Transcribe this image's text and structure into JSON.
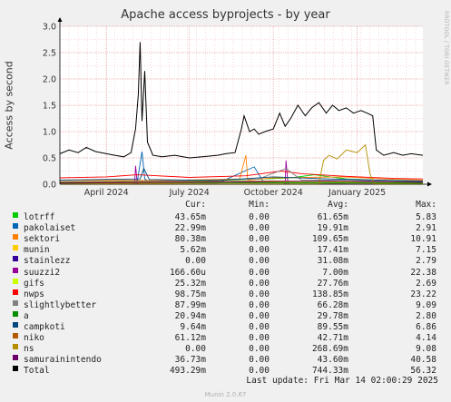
{
  "chart_data": {
    "type": "line",
    "title": "Apache access byprojects - by year",
    "ylabel": "Access by second",
    "xlabel": "",
    "ylim": [
      0,
      3.0
    ],
    "yticks": [
      "0.0",
      "0.5",
      "1.0",
      "1.5",
      "2.0",
      "2.5",
      "3.0"
    ],
    "ytick_values": [
      0,
      0.5,
      1.0,
      1.5,
      2.0,
      2.5,
      3.0
    ],
    "x_range": [
      "2024-02-10",
      "2025-03-14"
    ],
    "xticks": [
      {
        "date": "2024-04-01",
        "label": "April 2024"
      },
      {
        "date": "2024-07-01",
        "label": "July 2024"
      },
      {
        "date": "2024-10-01",
        "label": "October 2024"
      },
      {
        "date": "2025-01-01",
        "label": "January 2025"
      }
    ],
    "grid": true,
    "series": [
      {
        "name": "lotrff",
        "color": "#00cc00",
        "points": [
          [
            "2024-02-10",
            0.05
          ],
          [
            "2024-05-01",
            0.06
          ],
          [
            "2024-08-01",
            0.07
          ],
          [
            "2024-10-20",
            0.12
          ],
          [
            "2024-11-15",
            0.18
          ],
          [
            "2024-12-20",
            0.1
          ],
          [
            "2025-02-01",
            0.07
          ],
          [
            "2025-03-14",
            0.04
          ]
        ]
      },
      {
        "name": "pakolaiset",
        "color": "#0066b3",
        "points": [
          [
            "2024-02-10",
            0.02
          ],
          [
            "2024-04-10",
            0.03
          ],
          [
            "2024-05-05",
            0.06
          ],
          [
            "2024-05-10",
            0.62
          ],
          [
            "2024-05-13",
            0.1
          ],
          [
            "2024-05-20",
            0.03
          ],
          [
            "2024-08-01",
            0.02
          ],
          [
            "2024-09-10",
            0.33
          ],
          [
            "2024-09-20",
            0.05
          ],
          [
            "2024-12-01",
            0.02
          ],
          [
            "2025-03-14",
            0.02
          ]
        ]
      },
      {
        "name": "sektori",
        "color": "#ff8000",
        "points": [
          [
            "2024-02-10",
            0.08
          ],
          [
            "2024-06-01",
            0.07
          ],
          [
            "2024-08-25",
            0.1
          ],
          [
            "2024-09-01",
            0.55
          ],
          [
            "2024-09-03",
            0.08
          ],
          [
            "2024-10-01",
            0.12
          ],
          [
            "2024-12-15",
            0.14
          ],
          [
            "2025-02-01",
            0.1
          ],
          [
            "2025-03-14",
            0.08
          ]
        ]
      },
      {
        "name": "munin",
        "color": "#ffcc00",
        "points": [
          [
            "2024-02-10",
            0.01
          ],
          [
            "2024-08-01",
            0.02
          ],
          [
            "2025-01-01",
            0.02
          ],
          [
            "2025-03-14",
            0.01
          ]
        ]
      },
      {
        "name": "stainlezz",
        "color": "#330099",
        "points": [
          [
            "2024-02-10",
            0.03
          ],
          [
            "2024-07-01",
            0.03
          ],
          [
            "2024-10-01",
            0.04
          ],
          [
            "2025-03-14",
            0.03
          ]
        ]
      },
      {
        "name": "suuzzi2",
        "color": "#990099",
        "points": [
          [
            "2024-02-10",
            0.0
          ],
          [
            "2024-05-02",
            0.0
          ],
          [
            "2024-05-03",
            0.35
          ],
          [
            "2024-05-05",
            0.0
          ],
          [
            "2024-10-14",
            0.0
          ],
          [
            "2024-10-15",
            0.45
          ],
          [
            "2024-10-17",
            0.0
          ],
          [
            "2025-03-14",
            0.0
          ]
        ]
      },
      {
        "name": "gifs",
        "color": "#ccff00",
        "points": [
          [
            "2024-02-10",
            0.02
          ],
          [
            "2024-08-01",
            0.03
          ],
          [
            "2024-12-01",
            0.04
          ],
          [
            "2025-03-14",
            0.02
          ]
        ]
      },
      {
        "name": "nwps",
        "color": "#ff0000",
        "points": [
          [
            "2024-02-10",
            0.12
          ],
          [
            "2024-04-01",
            0.14
          ],
          [
            "2024-05-05",
            0.18
          ],
          [
            "2024-07-01",
            0.13
          ],
          [
            "2024-09-01",
            0.16
          ],
          [
            "2024-10-10",
            0.25
          ],
          [
            "2024-11-01",
            0.2
          ],
          [
            "2024-12-20",
            0.15
          ],
          [
            "2025-02-10",
            0.11
          ],
          [
            "2025-03-14",
            0.1
          ]
        ]
      },
      {
        "name": "slightlybetter",
        "color": "#808080",
        "points": [
          [
            "2024-02-10",
            0.05
          ],
          [
            "2024-06-01",
            0.06
          ],
          [
            "2024-09-15",
            0.1
          ],
          [
            "2024-10-15",
            0.3
          ],
          [
            "2024-11-01",
            0.08
          ],
          [
            "2025-03-14",
            0.06
          ]
        ]
      },
      {
        "name": "a",
        "color": "#008f00",
        "points": [
          [
            "2024-02-10",
            0.03
          ],
          [
            "2024-08-01",
            0.03
          ],
          [
            "2025-03-14",
            0.02
          ]
        ]
      },
      {
        "name": "campkoti",
        "color": "#00487d",
        "points": [
          [
            "2024-02-10",
            0.08
          ],
          [
            "2024-05-08",
            0.1
          ],
          [
            "2024-05-12",
            0.3
          ],
          [
            "2024-05-18",
            0.09
          ],
          [
            "2024-08-01",
            0.07
          ],
          [
            "2024-10-01",
            0.14
          ],
          [
            "2024-12-01",
            0.1
          ],
          [
            "2025-03-14",
            0.06
          ]
        ]
      },
      {
        "name": "niko",
        "color": "#b35a00",
        "points": [
          [
            "2024-02-10",
            0.04
          ],
          [
            "2024-07-01",
            0.05
          ],
          [
            "2024-10-01",
            0.06
          ],
          [
            "2025-03-14",
            0.04
          ]
        ]
      },
      {
        "name": "ns",
        "color": "#b38f00",
        "points": [
          [
            "2024-02-10",
            0.0
          ],
          [
            "2024-11-20",
            0.0
          ],
          [
            "2024-11-25",
            0.45
          ],
          [
            "2024-12-01",
            0.55
          ],
          [
            "2024-12-10",
            0.48
          ],
          [
            "2024-12-20",
            0.65
          ],
          [
            "2025-01-01",
            0.6
          ],
          [
            "2025-01-10",
            0.75
          ],
          [
            "2025-01-15",
            0.2
          ],
          [
            "2025-01-20",
            0.0
          ],
          [
            "2025-03-14",
            0.0
          ]
        ]
      },
      {
        "name": "samurainintendo",
        "color": "#6b006b",
        "points": [
          [
            "2024-02-10",
            0.02
          ],
          [
            "2024-08-01",
            0.04
          ],
          [
            "2024-12-01",
            0.06
          ],
          [
            "2025-03-14",
            0.04
          ]
        ]
      },
      {
        "name": "Total",
        "color": "#000000",
        "points": [
          [
            "2024-02-10",
            0.58
          ],
          [
            "2024-02-20",
            0.65
          ],
          [
            "2024-03-01",
            0.6
          ],
          [
            "2024-03-10",
            0.7
          ],
          [
            "2024-03-20",
            0.62
          ],
          [
            "2024-04-01",
            0.58
          ],
          [
            "2024-04-10",
            0.55
          ],
          [
            "2024-04-20",
            0.52
          ],
          [
            "2024-04-28",
            0.6
          ],
          [
            "2024-05-03",
            1.05
          ],
          [
            "2024-05-06",
            1.7
          ],
          [
            "2024-05-08",
            2.7
          ],
          [
            "2024-05-10",
            1.2
          ],
          [
            "2024-05-13",
            2.15
          ],
          [
            "2024-05-16",
            0.8
          ],
          [
            "2024-05-22",
            0.55
          ],
          [
            "2024-06-01",
            0.52
          ],
          [
            "2024-06-15",
            0.55
          ],
          [
            "2024-07-01",
            0.5
          ],
          [
            "2024-07-15",
            0.52
          ],
          [
            "2024-08-01",
            0.55
          ],
          [
            "2024-08-10",
            0.58
          ],
          [
            "2024-08-20",
            0.6
          ],
          [
            "2024-08-27",
            1.05
          ],
          [
            "2024-08-30",
            1.3
          ],
          [
            "2024-09-05",
            1.0
          ],
          [
            "2024-09-10",
            1.05
          ],
          [
            "2024-09-15",
            0.95
          ],
          [
            "2024-09-22",
            1.0
          ],
          [
            "2024-10-01",
            1.05
          ],
          [
            "2024-10-08",
            1.35
          ],
          [
            "2024-10-14",
            1.1
          ],
          [
            "2024-10-20",
            1.25
          ],
          [
            "2024-10-28",
            1.5
          ],
          [
            "2024-11-05",
            1.3
          ],
          [
            "2024-11-12",
            1.45
          ],
          [
            "2024-11-20",
            1.55
          ],
          [
            "2024-11-28",
            1.35
          ],
          [
            "2024-12-05",
            1.5
          ],
          [
            "2024-12-12",
            1.4
          ],
          [
            "2024-12-20",
            1.45
          ],
          [
            "2024-12-28",
            1.35
          ],
          [
            "2025-01-05",
            1.4
          ],
          [
            "2025-01-12",
            1.35
          ],
          [
            "2025-01-18",
            1.3
          ],
          [
            "2025-01-22",
            0.65
          ],
          [
            "2025-01-30",
            0.55
          ],
          [
            "2025-02-10",
            0.6
          ],
          [
            "2025-02-20",
            0.55
          ],
          [
            "2025-03-01",
            0.58
          ],
          [
            "2025-03-14",
            0.55
          ]
        ]
      }
    ]
  },
  "header": {
    "side_label": "RRDTOOL / TOBI OETIKER"
  },
  "legend": {
    "columns": {
      "cur": "Cur:",
      "min": "Min:",
      "avg": "Avg:",
      "max": "Max:"
    },
    "rows": [
      {
        "name": "lotrff",
        "color": "#00cc00",
        "cur": "43.65m",
        "min": "0.00",
        "avg": "61.65m",
        "max": "5.83"
      },
      {
        "name": "pakolaiset",
        "color": "#0066b3",
        "cur": "22.99m",
        "min": "0.00",
        "avg": "19.91m",
        "max": "2.91"
      },
      {
        "name": "sektori",
        "color": "#ff8000",
        "cur": "80.38m",
        "min": "0.00",
        "avg": "109.65m",
        "max": "10.91"
      },
      {
        "name": "munin",
        "color": "#ffcc00",
        "cur": "5.62m",
        "min": "0.00",
        "avg": "17.41m",
        "max": "7.15"
      },
      {
        "name": "stainlezz",
        "color": "#330099",
        "cur": "0.00",
        "min": "0.00",
        "avg": "31.08m",
        "max": "2.79"
      },
      {
        "name": "suuzzi2",
        "color": "#990099",
        "cur": "166.60u",
        "min": "0.00",
        "avg": "7.00m",
        "max": "22.38"
      },
      {
        "name": "gifs",
        "color": "#ccff00",
        "cur": "25.32m",
        "min": "0.00",
        "avg": "27.76m",
        "max": "2.69"
      },
      {
        "name": "nwps",
        "color": "#ff0000",
        "cur": "98.75m",
        "min": "0.00",
        "avg": "138.85m",
        "max": "23.22"
      },
      {
        "name": "slightlybetter",
        "color": "#808080",
        "cur": "87.99m",
        "min": "0.00",
        "avg": "66.28m",
        "max": "9.09"
      },
      {
        "name": "a",
        "color": "#008f00",
        "cur": "20.94m",
        "min": "0.00",
        "avg": "29.78m",
        "max": "2.80"
      },
      {
        "name": "campkoti",
        "color": "#00487d",
        "cur": "9.64m",
        "min": "0.00",
        "avg": "89.55m",
        "max": "6.86"
      },
      {
        "name": "niko",
        "color": "#b35a00",
        "cur": "61.12m",
        "min": "0.00",
        "avg": "42.71m",
        "max": "4.14"
      },
      {
        "name": "ns",
        "color": "#b38f00",
        "cur": "0.00",
        "min": "0.00",
        "avg": "268.69m",
        "max": "9.08"
      },
      {
        "name": "samurainintendo",
        "color": "#6b006b",
        "cur": "36.73m",
        "min": "0.00",
        "avg": "43.60m",
        "max": "40.58"
      },
      {
        "name": "Total",
        "color": "#000000",
        "cur": "493.29m",
        "min": "0.00",
        "avg": "744.33m",
        "max": "56.32"
      }
    ]
  },
  "footer": {
    "last_update": "Last update: Fri Mar 14 02:00:29 2025",
    "version": "Munin 2.0.67"
  }
}
